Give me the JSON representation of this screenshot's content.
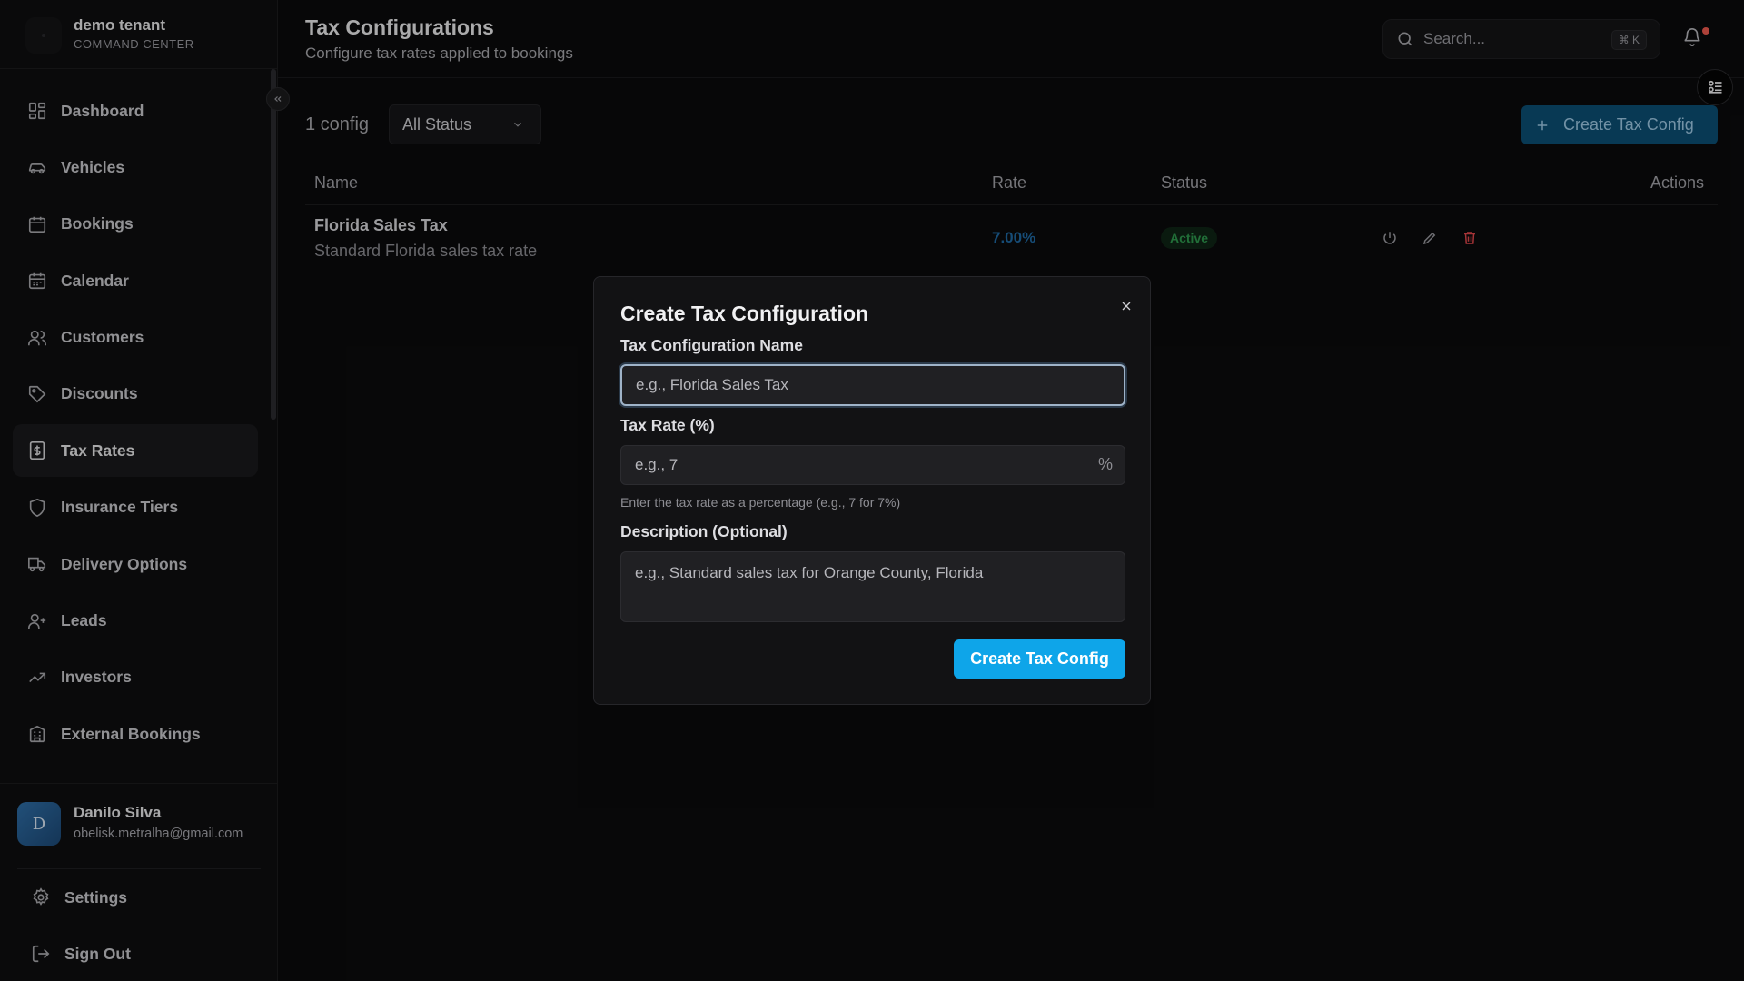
{
  "brand": {
    "name": "demo tenant",
    "subtitle": "COMMAND CENTER"
  },
  "sidebar": {
    "items": [
      {
        "label": "Dashboard",
        "icon": "dashboard-icon"
      },
      {
        "label": "Vehicles",
        "icon": "car-icon"
      },
      {
        "label": "Bookings",
        "icon": "calendar-icon"
      },
      {
        "label": "Calendar",
        "icon": "calendar-icon"
      },
      {
        "label": "Customers",
        "icon": "users-icon"
      },
      {
        "label": "Discounts",
        "icon": "tag-icon"
      },
      {
        "label": "Tax Rates",
        "icon": "dollar-receipt-icon",
        "active": true
      },
      {
        "label": "Insurance Tiers",
        "icon": "shield-icon"
      },
      {
        "label": "Delivery Options",
        "icon": "truck-icon"
      },
      {
        "label": "Leads",
        "icon": "user-plus-icon"
      },
      {
        "label": "Investors",
        "icon": "trending-up-icon"
      },
      {
        "label": "External Bookings",
        "icon": "building-icon"
      }
    ]
  },
  "user": {
    "initial": "D",
    "name": "Danilo Silva",
    "email": "obelisk.metralha@gmail.com"
  },
  "bottom_nav": {
    "settings": "Settings",
    "sign_out": "Sign Out"
  },
  "header": {
    "title": "Tax Configurations",
    "subtitle": "Configure tax rates applied to bookings",
    "search_placeholder": "Search...",
    "search_shortcut": "⌘ K"
  },
  "toolbar": {
    "count": "1 config",
    "status_filter": "All Status",
    "create_label": "Create Tax Config"
  },
  "table": {
    "columns": {
      "name": "Name",
      "rate": "Rate",
      "status": "Status",
      "actions": "Actions"
    },
    "rows": [
      {
        "name": "Florida Sales Tax",
        "description": "Standard Florida sales tax rate",
        "rate": "7.00%",
        "status": "Active"
      }
    ]
  },
  "modal": {
    "title": "Create Tax Configuration",
    "name_label": "Tax Configuration Name",
    "name_placeholder": "e.g., Florida Sales Tax",
    "rate_label": "Tax Rate (%)",
    "rate_placeholder": "e.g., 7",
    "rate_suffix": "%",
    "rate_hint": "Enter the tax rate as a percentage (e.g., 7 for 7%)",
    "description_label": "Description (Optional)",
    "description_placeholder": "e.g., Standard sales tax for Orange County, Florida",
    "submit_label": "Create Tax Config"
  },
  "colors": {
    "accent": "#0ea5e9",
    "primary_dim": "#0c4f75",
    "active_badge": "#2e9a4e",
    "danger": "#e5484d",
    "rate_text": "#1f6aa5"
  }
}
